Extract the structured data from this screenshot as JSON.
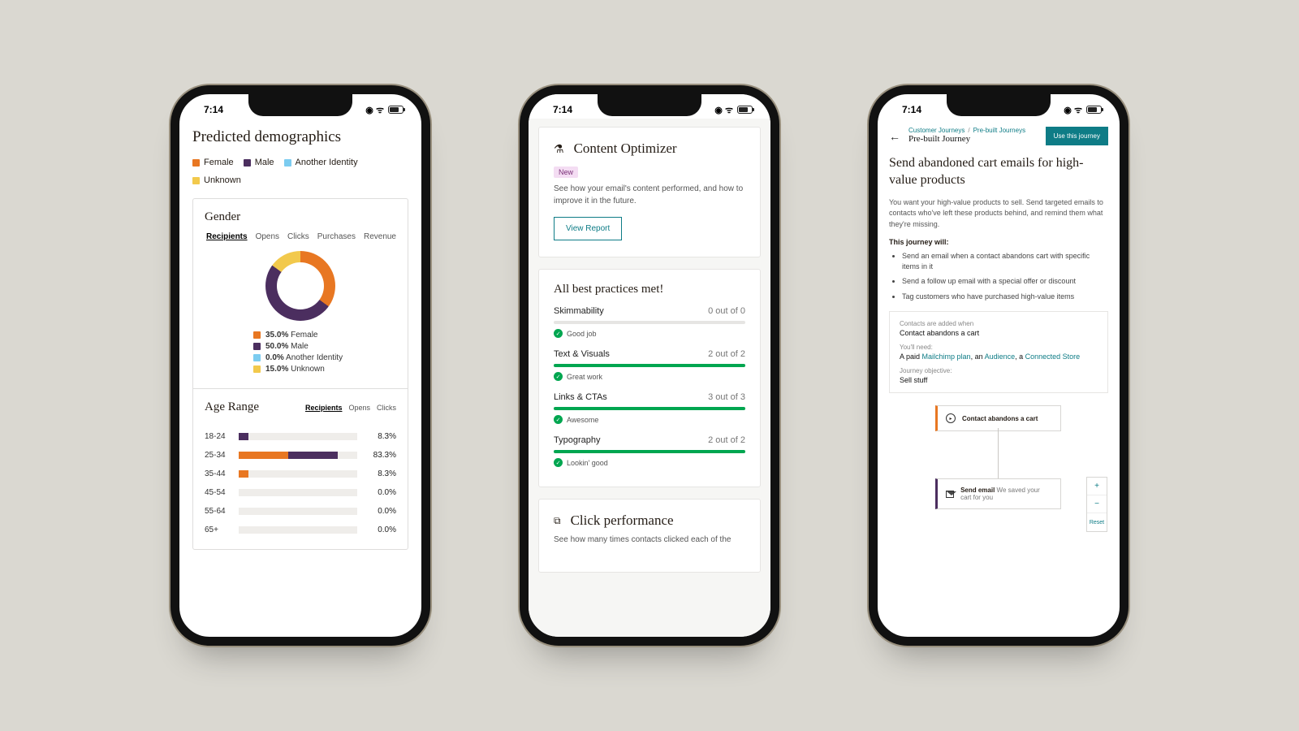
{
  "status": {
    "time": "7:14"
  },
  "colors": {
    "female": "#e87722",
    "male": "#4b2e5f",
    "another": "#7cccf0",
    "unknown": "#f2c94c",
    "green": "#00a650",
    "teal": "#0e7c86"
  },
  "phone1": {
    "title": "Predicted demographics",
    "legend": [
      "Female",
      "Male",
      "Another Identity",
      "Unknown"
    ],
    "gender": {
      "title": "Gender",
      "tabs": [
        "Recipients",
        "Opens",
        "Clicks",
        "Purchases",
        "Revenue"
      ],
      "breakdown": [
        {
          "label": "Female",
          "pct": "35.0%",
          "color": "#e87722"
        },
        {
          "label": "Male",
          "pct": "50.0%",
          "color": "#4b2e5f"
        },
        {
          "label": "Another Identity",
          "pct": "0.0%",
          "color": "#7cccf0"
        },
        {
          "label": "Unknown",
          "pct": "15.0%",
          "color": "#f2c94c"
        }
      ]
    },
    "age": {
      "title": "Age Range",
      "tabs": [
        "Recipients",
        "Opens",
        "Clicks"
      ],
      "rows": [
        {
          "label": "18-24",
          "pct": "8.3%",
          "segs": [
            {
              "color": "#4b2e5f",
              "w": 8.3,
              "left": 0
            }
          ]
        },
        {
          "label": "25-34",
          "pct": "83.3%",
          "segs": [
            {
              "color": "#e87722",
              "w": 42,
              "left": 0
            },
            {
              "color": "#4b2e5f",
              "w": 41.3,
              "left": 42
            }
          ]
        },
        {
          "label": "35-44",
          "pct": "8.3%",
          "segs": [
            {
              "color": "#e87722",
              "w": 8.3,
              "left": 0
            }
          ]
        },
        {
          "label": "45-54",
          "pct": "0.0%",
          "segs": []
        },
        {
          "label": "55-64",
          "pct": "0.0%",
          "segs": []
        },
        {
          "label": "65+",
          "pct": "0.0%",
          "segs": []
        }
      ]
    }
  },
  "phone2": {
    "optimizer": {
      "title": "Content Optimizer",
      "badge": "New",
      "desc": "See how your email's content performed, and how to improve it in the future.",
      "cta": "View Report"
    },
    "best_practices": {
      "title": "All best practices met!",
      "items": [
        {
          "label": "Skimmability",
          "score": "0 out of 0",
          "fill": 0,
          "note": "Good job"
        },
        {
          "label": "Text & Visuals",
          "score": "2 out of 2",
          "fill": 100,
          "note": "Great work"
        },
        {
          "label": "Links & CTAs",
          "score": "3 out of 3",
          "fill": 100,
          "note": "Awesome"
        },
        {
          "label": "Typography",
          "score": "2 out of 2",
          "fill": 100,
          "note": "Lookin' good"
        }
      ]
    },
    "click_perf": {
      "title": "Click performance",
      "desc": "See how many times contacts clicked each of the"
    }
  },
  "phone3": {
    "breadcrumb": [
      "Customer Journeys",
      "Pre-built Journeys"
    ],
    "head_title": "Pre-built Journey",
    "cta": "Use this journey",
    "title": "Send abandoned cart emails for high-value products",
    "desc": "You want your high-value products to sell. Send targeted emails to contacts who've left these products behind, and remind them what they're missing.",
    "will_label": "This journey will:",
    "will_items": [
      "Send an email when a contact abandons cart with specific items in it",
      "Send a follow up email with a special offer or discount",
      "Tag customers who have purchased high-value items"
    ],
    "info": {
      "added_label": "Contacts are added when",
      "added_value": "Contact abandons a cart",
      "need_label": "You'll need:",
      "need_prefix": "A paid ",
      "need_link1": "Mailchimp plan",
      "need_mid1": ", an ",
      "need_link2": "Audience",
      "need_mid2": ", a ",
      "need_link3": "Connected Store",
      "obj_label": "Journey objective:",
      "obj_value": "Sell stuff"
    },
    "flow": {
      "start": "Contact abandons a cart",
      "email_prefix": "Send email",
      "email_text": "We saved your cart for you",
      "zoom_reset": "Reset"
    }
  },
  "chart_data": [
    {
      "type": "pie",
      "title": "Gender",
      "series": [
        {
          "name": "Recipients",
          "values": [
            35.0,
            50.0,
            0.0,
            15.0
          ]
        }
      ],
      "categories": [
        "Female",
        "Male",
        "Another Identity",
        "Unknown"
      ]
    },
    {
      "type": "bar",
      "title": "Age Range",
      "orientation": "horizontal",
      "stacked": true,
      "categories": [
        "18-24",
        "25-34",
        "35-44",
        "45-54",
        "55-64",
        "65+"
      ],
      "series": [
        {
          "name": "Female",
          "values": [
            0,
            42.0,
            8.3,
            0,
            0,
            0
          ]
        },
        {
          "name": "Male",
          "values": [
            8.3,
            41.3,
            0,
            0,
            0,
            0
          ]
        }
      ],
      "xlabel": "",
      "ylabel": "",
      "xlim": [
        0,
        100
      ],
      "totals": [
        8.3,
        83.3,
        8.3,
        0.0,
        0.0,
        0.0
      ]
    },
    {
      "type": "bar",
      "title": "All best practices met!",
      "categories": [
        "Skimmability",
        "Text & Visuals",
        "Links & CTAs",
        "Typography"
      ],
      "values": [
        0,
        2,
        3,
        2
      ],
      "max_values": [
        0,
        2,
        3,
        2
      ],
      "xlabel": "",
      "ylabel": ""
    }
  ]
}
